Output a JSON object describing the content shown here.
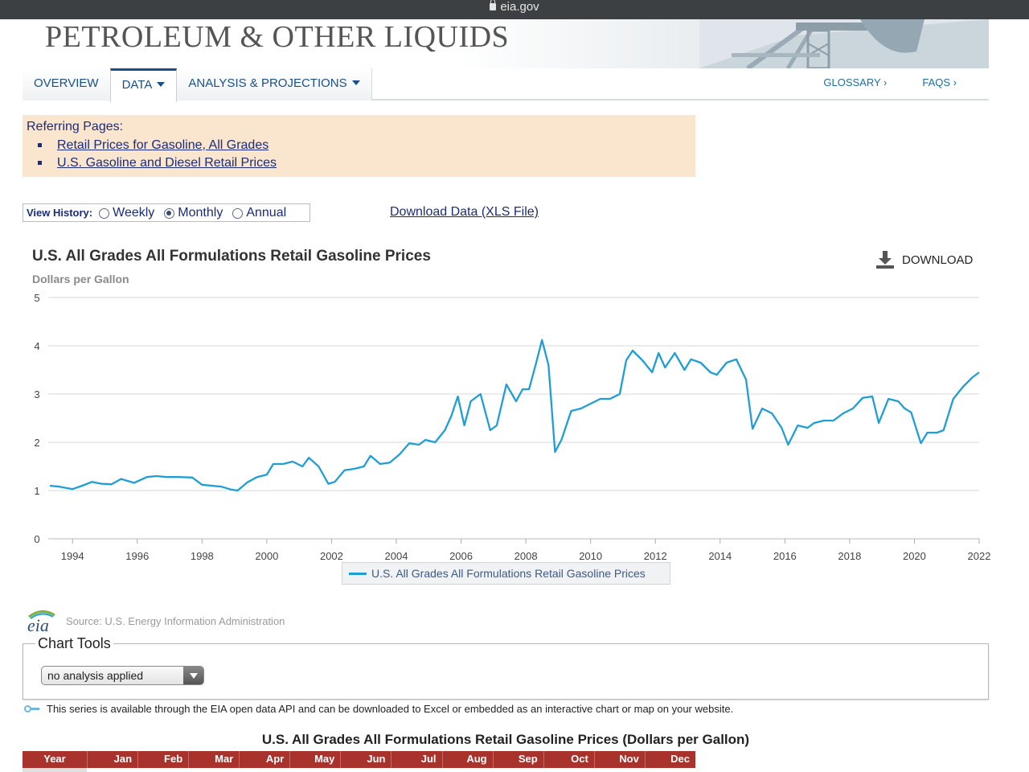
{
  "browser": {
    "url": "eia.gov"
  },
  "banner": {
    "title": "PETROLEUM & OTHER LIQUIDS"
  },
  "nav": {
    "tabs": [
      {
        "label": "OVERVIEW"
      },
      {
        "label": "DATA"
      },
      {
        "label": "ANALYSIS & PROJECTIONS"
      }
    ],
    "right": [
      {
        "label": "GLOSSARY ›"
      },
      {
        "label": "FAQS ›"
      }
    ]
  },
  "referring": {
    "title": "Referring Pages:",
    "links": [
      {
        "label": "Retail Prices for Gasoline, All Grades"
      },
      {
        "label": "U.S. Gasoline and Diesel Retail Prices"
      }
    ]
  },
  "view_history": {
    "label": "View History:",
    "options": [
      {
        "label": "Weekly",
        "selected": false
      },
      {
        "label": "Monthly",
        "selected": true
      },
      {
        "label": "Annual",
        "selected": false
      }
    ]
  },
  "download_link": "Download Data (XLS File)",
  "chart_header": {
    "title": "U.S. All Grades All Formulations Retail Gasoline Prices",
    "units": "Dollars per Gallon",
    "download_label": "DOWNLOAD"
  },
  "chart_data": {
    "type": "line",
    "title": "U.S. All Grades All Formulations Retail Gasoline Prices",
    "ylabel": "Dollars per Gallon",
    "xlabel": "",
    "ylim": [
      0,
      5
    ],
    "xlim": [
      1993.25,
      2022.0
    ],
    "yticks": [
      0,
      1,
      2,
      3,
      4,
      5
    ],
    "xticks": [
      1994,
      1996,
      1998,
      2000,
      2002,
      2004,
      2006,
      2008,
      2010,
      2012,
      2014,
      2016,
      2018,
      2020,
      2022
    ],
    "grid": true,
    "legend": "bottom-center",
    "color": "#1f9ed6",
    "series": [
      {
        "name": "U.S. All Grades All Formulations Retail Gasoline Prices",
        "x": [
          1993.3,
          1993.6,
          1994.0,
          1994.3,
          1994.6,
          1994.9,
          1995.2,
          1995.5,
          1995.9,
          1996.3,
          1996.6,
          1996.9,
          1997.3,
          1997.7,
          1998.0,
          1998.3,
          1998.6,
          1998.9,
          1999.1,
          1999.4,
          1999.7,
          2000.0,
          2000.2,
          2000.5,
          2000.8,
          2001.1,
          2001.3,
          2001.6,
          2001.9,
          2002.1,
          2002.4,
          2002.7,
          2003.0,
          2003.2,
          2003.5,
          2003.8,
          2004.1,
          2004.4,
          2004.7,
          2004.9,
          2005.2,
          2005.5,
          2005.7,
          2005.9,
          2006.1,
          2006.3,
          2006.6,
          2006.9,
          2007.1,
          2007.4,
          2007.7,
          2007.9,
          2008.1,
          2008.3,
          2008.5,
          2008.7,
          2008.9,
          2009.1,
          2009.4,
          2009.7,
          2010.0,
          2010.3,
          2010.6,
          2010.9,
          2011.1,
          2011.3,
          2011.6,
          2011.9,
          2012.1,
          2012.3,
          2012.6,
          2012.9,
          2013.1,
          2013.4,
          2013.7,
          2013.9,
          2014.2,
          2014.5,
          2014.8,
          2015.0,
          2015.3,
          2015.6,
          2015.9,
          2016.1,
          2016.4,
          2016.7,
          2016.9,
          2017.2,
          2017.5,
          2017.8,
          2018.1,
          2018.4,
          2018.7,
          2018.9,
          2019.2,
          2019.5,
          2019.7,
          2019.9,
          2020.2,
          2020.4,
          2020.7,
          2020.9,
          2021.2,
          2021.5,
          2021.8,
          2022.0
        ],
        "y": [
          1.1,
          1.08,
          1.03,
          1.1,
          1.18,
          1.14,
          1.13,
          1.24,
          1.16,
          1.28,
          1.3,
          1.28,
          1.28,
          1.27,
          1.12,
          1.1,
          1.08,
          1.02,
          1.0,
          1.17,
          1.28,
          1.33,
          1.55,
          1.55,
          1.6,
          1.5,
          1.68,
          1.5,
          1.14,
          1.18,
          1.42,
          1.45,
          1.5,
          1.72,
          1.55,
          1.58,
          1.75,
          1.98,
          1.95,
          2.05,
          2.0,
          2.25,
          2.55,
          2.95,
          2.35,
          2.85,
          3.0,
          2.25,
          2.35,
          3.2,
          2.85,
          3.1,
          3.1,
          3.6,
          4.12,
          3.6,
          1.8,
          2.05,
          2.65,
          2.7,
          2.8,
          2.9,
          2.9,
          3.0,
          3.7,
          3.9,
          3.7,
          3.45,
          3.85,
          3.55,
          3.85,
          3.5,
          3.72,
          3.65,
          3.45,
          3.4,
          3.65,
          3.72,
          3.3,
          2.28,
          2.7,
          2.6,
          2.3,
          1.95,
          2.35,
          2.3,
          2.4,
          2.45,
          2.45,
          2.6,
          2.7,
          2.92,
          2.95,
          2.4,
          2.9,
          2.85,
          2.7,
          2.62,
          1.98,
          2.2,
          2.2,
          2.25,
          2.9,
          3.15,
          3.35,
          3.45
        ]
      }
    ]
  },
  "source": {
    "logo_text": "eia",
    "text": "Source: U.S. Energy Information Administration"
  },
  "chart_tools": {
    "title": "Chart Tools",
    "select_value": "no analysis applied"
  },
  "api_note": "This series is available through the EIA open data API and can be downloaded to Excel or embedded as an interactive chart or map on your website.",
  "data_table": {
    "title": "U.S. All Grades All Formulations Retail Gasoline Prices (Dollars per Gallon)",
    "columns": [
      "Year",
      "Jan",
      "Feb",
      "Mar",
      "Apr",
      "May",
      "Jun",
      "Jul",
      "Aug",
      "Sep",
      "Oct",
      "Nov",
      "Dec"
    ]
  }
}
